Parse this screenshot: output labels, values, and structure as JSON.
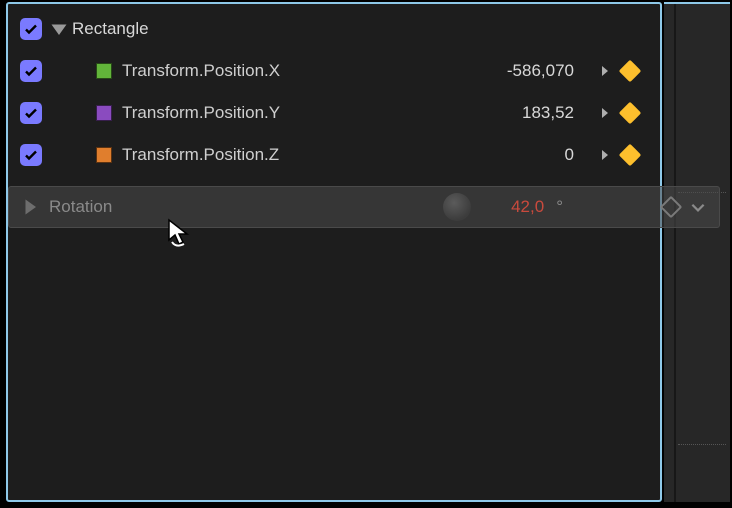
{
  "group": {
    "name": "Rectangle",
    "expanded": true,
    "rows": [
      {
        "key": "x",
        "label": "Transform.Position.X",
        "value": "-586,070",
        "swatch": "#62b53a"
      },
      {
        "key": "y",
        "label": "Transform.Position.Y",
        "value": "183,52",
        "swatch": "#8a4bbf"
      },
      {
        "key": "z",
        "label": "Transform.Position.Z",
        "value": "0",
        "swatch": "#e07e2d"
      }
    ]
  },
  "drag": {
    "label": "Rotation",
    "value": "42,0",
    "unit": "°"
  }
}
